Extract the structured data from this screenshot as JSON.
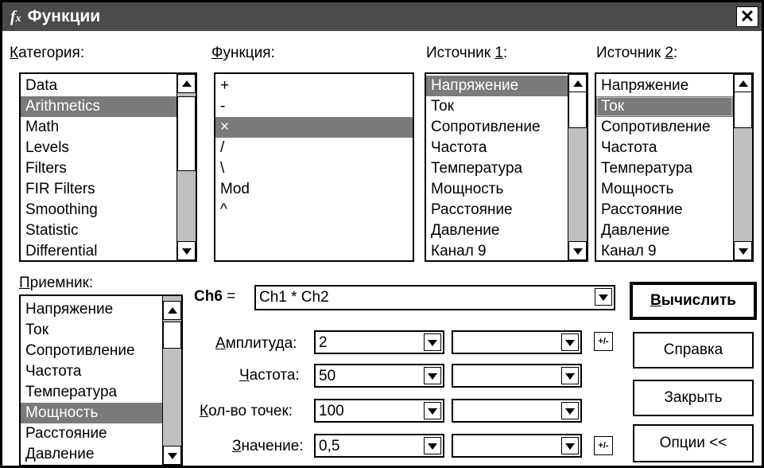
{
  "window": {
    "title": "Функции",
    "fx_glyph": "fx",
    "close_glyph": "✕"
  },
  "category": {
    "label": "Категория:",
    "items": [
      "Data",
      "Arithmetics",
      "Math",
      "Levels",
      "Filters",
      "FIR Filters",
      "Smoothing",
      "Statistic",
      "Differential"
    ],
    "selected": "Arithmetics"
  },
  "function": {
    "label": "Функция:",
    "items": [
      "+",
      "-",
      "×",
      "/",
      "\\",
      "Mod",
      "^"
    ],
    "selected": "×"
  },
  "source1": {
    "label": "Источник 1:",
    "items": [
      "Напряжение",
      "Ток",
      "Сопротивление",
      "Частота",
      "Температура",
      "Мощность",
      "Расстояние",
      "Давление",
      "Канал 9"
    ],
    "selected": "Напряжение"
  },
  "source2": {
    "label": "Источник 2:",
    "items": [
      "Напряжение",
      "Ток",
      "Сопротивление",
      "Частота",
      "Температура",
      "Мощность",
      "Расстояние",
      "Давление",
      "Канал 9"
    ],
    "selected": "Ток"
  },
  "receiver": {
    "label": "Приемник:",
    "items": [
      "Напряжение",
      "Ток",
      "Сопротивление",
      "Частота",
      "Температура",
      "Мощность",
      "Расстояние",
      "Давление"
    ],
    "selected": "Мощность"
  },
  "formula": {
    "channel": "Ch6",
    "equals": "=",
    "expression": "Ch1 * Ch2"
  },
  "params": {
    "amplitude": {
      "label": "Амплитуда:",
      "value": "2",
      "value2": ""
    },
    "frequency": {
      "label": "Частота:",
      "value": "50",
      "value2": ""
    },
    "points": {
      "label": "Кол-во точек:",
      "value": "100",
      "value2": ""
    },
    "value": {
      "label": "Значение:",
      "value": "0,5",
      "value2": ""
    },
    "pm_glyph": "+/-"
  },
  "buttons": {
    "calculate": "Вычислить",
    "help": "Справка",
    "close": "Закрыть",
    "options": "Опции <<"
  }
}
